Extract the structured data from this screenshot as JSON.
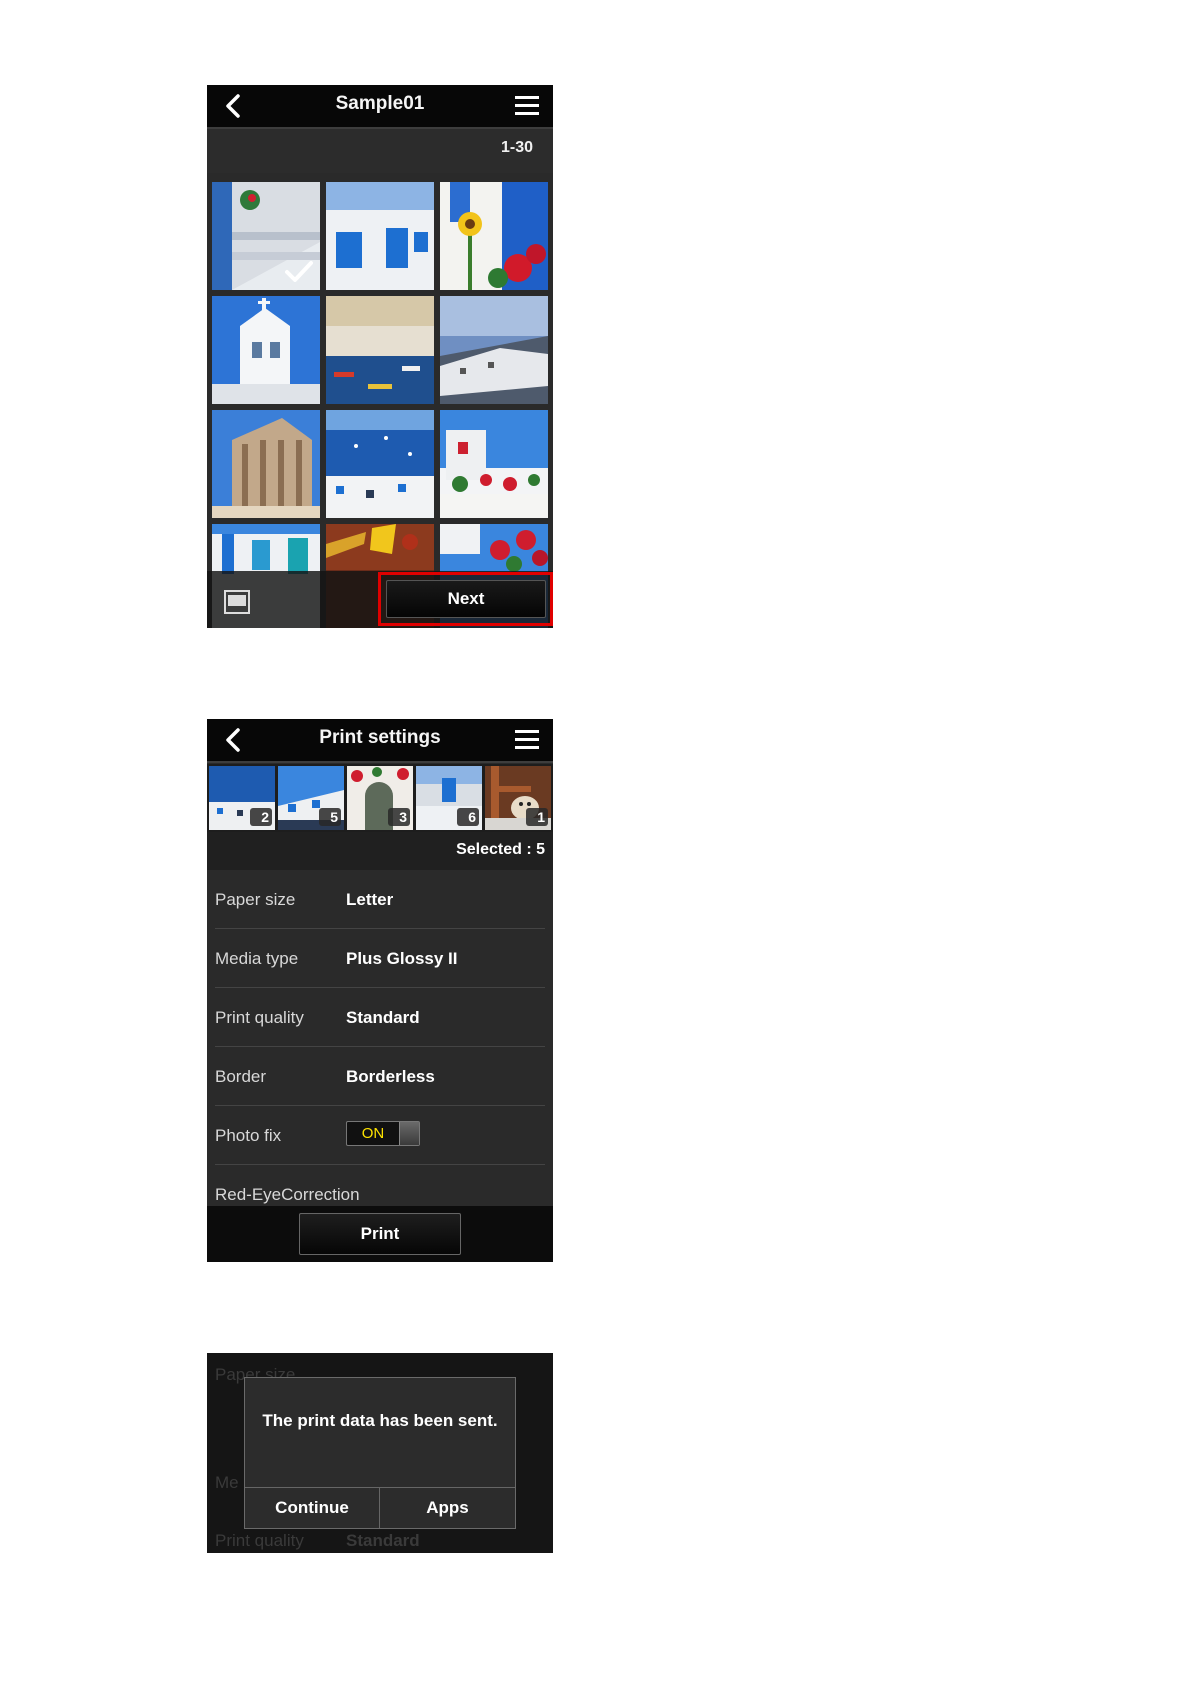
{
  "photo_list_screen": {
    "title": "Sample01",
    "range": "1-30",
    "next_label": "Next",
    "accent_highlight": "#e00000"
  },
  "print_settings_screen": {
    "title": "Print settings",
    "thumbnail_counts": [
      "2",
      "5",
      "3",
      "6",
      "1"
    ],
    "selected_label": "Selected : 5",
    "settings": [
      {
        "label": "Paper size",
        "value": "Letter"
      },
      {
        "label": "Media type",
        "value": "Plus Glossy II"
      },
      {
        "label": "Print quality",
        "value": "Standard"
      },
      {
        "label": "Border",
        "value": "Borderless"
      },
      {
        "label": "Photo fix",
        "toggle": "ON"
      },
      {
        "label": "Red-EyeCorrection"
      }
    ],
    "print_label": "Print",
    "toggle_color": "#ffe400"
  },
  "sent_dialog_screen": {
    "background_items": {
      "paper_size_label": "Paper size",
      "media_fragment": "Me",
      "print_quality_label": "Print quality",
      "print_quality_value": "Standard"
    },
    "message": "The print data has been sent.",
    "continue_label": "Continue",
    "apps_label": "Apps"
  }
}
